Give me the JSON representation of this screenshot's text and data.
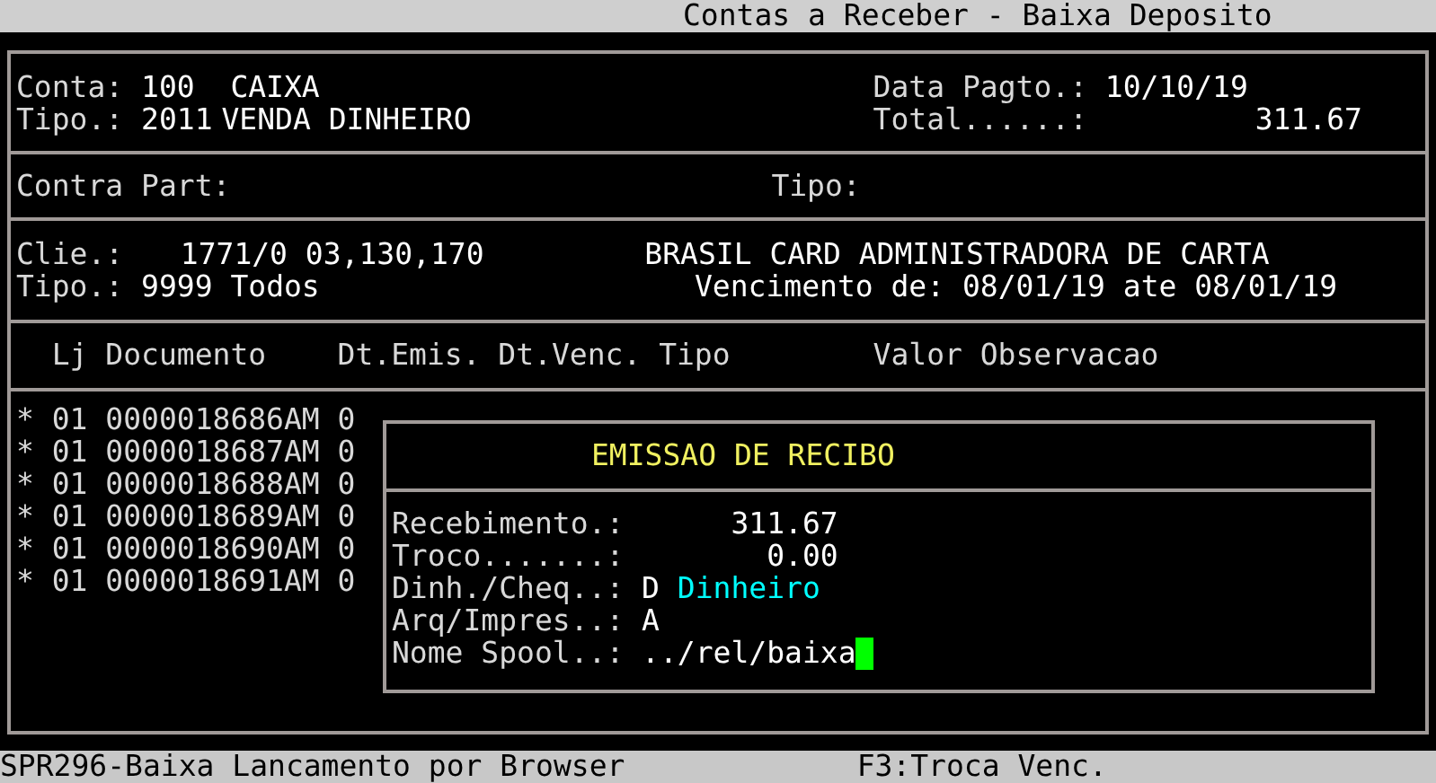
{
  "title": "Contas a Receber - Baixa Deposito",
  "header": {
    "conta_label": "Conta:",
    "conta": "100",
    "conta_name": "CAIXA",
    "data_pagto_label": "Data Pagto.:",
    "data_pagto": "10/10/19",
    "tipo_label": "Tipo.:",
    "tipo": "2011",
    "tipo_name": "VENDA DINHEIRO",
    "total_label": "Total......:",
    "total": "311.67"
  },
  "contra_part": {
    "label": "Contra Part:",
    "tipo_label": "Tipo:"
  },
  "cliente": {
    "label": "Clie.:",
    "codigo": "1771/0 03,130,170",
    "nome": "BRASIL CARD ADMINISTRADORA DE CARTA",
    "tipo_label": "Tipo.:",
    "tipo": "9999 Todos",
    "vencimento": "Vencimento de: 08/01/19 ate 08/01/19"
  },
  "table": {
    "columns": [
      "",
      "Lj",
      "Documento",
      "Dt.Emis.",
      "Dt.Venc.",
      "Tipo",
      "Valor",
      "Observacao"
    ],
    "rows": [
      {
        "cells": [
          "*",
          "01",
          "0000018686AM",
          "0"
        ]
      },
      {
        "cells": [
          "*",
          "01",
          "0000018687AM",
          "0"
        ]
      },
      {
        "cells": [
          "*",
          "01",
          "0000018688AM",
          "0"
        ]
      },
      {
        "cells": [
          "*",
          "01",
          "0000018689AM",
          "0"
        ]
      },
      {
        "cells": [
          "*",
          "01",
          "0000018690AM",
          "0"
        ]
      },
      {
        "cells": [
          "*",
          "01",
          "0000018691AM",
          "0"
        ]
      }
    ]
  },
  "dialog": {
    "title": "EMISSAO DE RECIBO",
    "fields": [
      {
        "kind": "amount",
        "label": "Recebimento.:",
        "value": "311.67"
      },
      {
        "kind": "amount",
        "label": "Troco.......:",
        "value": "0.00"
      },
      {
        "kind": "choice",
        "label": "Dinh./Cheq..:",
        "value": "D",
        "description": "Dinheiro"
      },
      {
        "kind": "code",
        "label": "Arq/Impres..:",
        "value": "A"
      },
      {
        "kind": "input",
        "label": "Nome Spool..:",
        "value": "../rel/baixa"
      }
    ]
  },
  "status_bar": [
    "SPR296-Baixa Lancamento por Browser",
    "F3:Troca Venc."
  ]
}
